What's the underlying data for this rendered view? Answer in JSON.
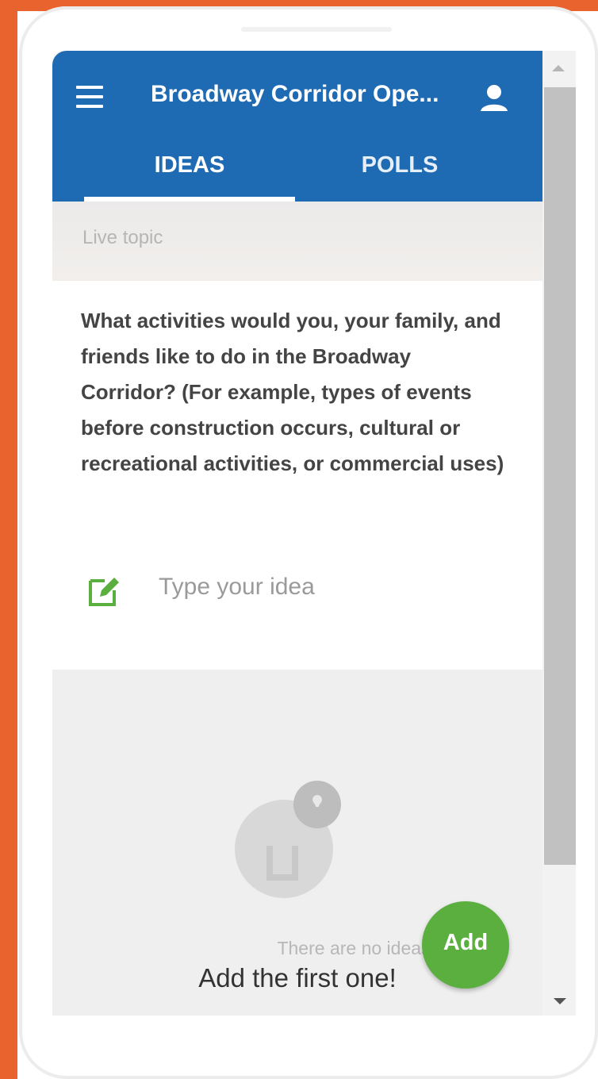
{
  "app": {
    "title": "Broadway Corridor Ope...",
    "accent_color": "#1e6bb4",
    "brand_frame_color": "#e8632e"
  },
  "header": {
    "menu_icon": "hamburger-menu-icon",
    "user_icon": "user-account-icon"
  },
  "tabs": [
    {
      "label": "IDEAS",
      "active": true
    },
    {
      "label": "POLLS",
      "active": false
    }
  ],
  "live_topic": {
    "label": "Live topic",
    "question": "What activities would you, your family, and friends like to do in the Broadway Corridor? (For example, types of events before construction occurs, cultural or recreational activities, or commercial uses)"
  },
  "idea_input": {
    "icon": "edit-note-icon",
    "placeholder": "Type your idea",
    "value": ""
  },
  "empty_state": {
    "illustration": "idea-bulb-illustration",
    "message": "There are no ideas yet.",
    "call_to_action": "Add the first one!"
  },
  "fab": {
    "label": "Add",
    "color": "#5aaf3f"
  }
}
